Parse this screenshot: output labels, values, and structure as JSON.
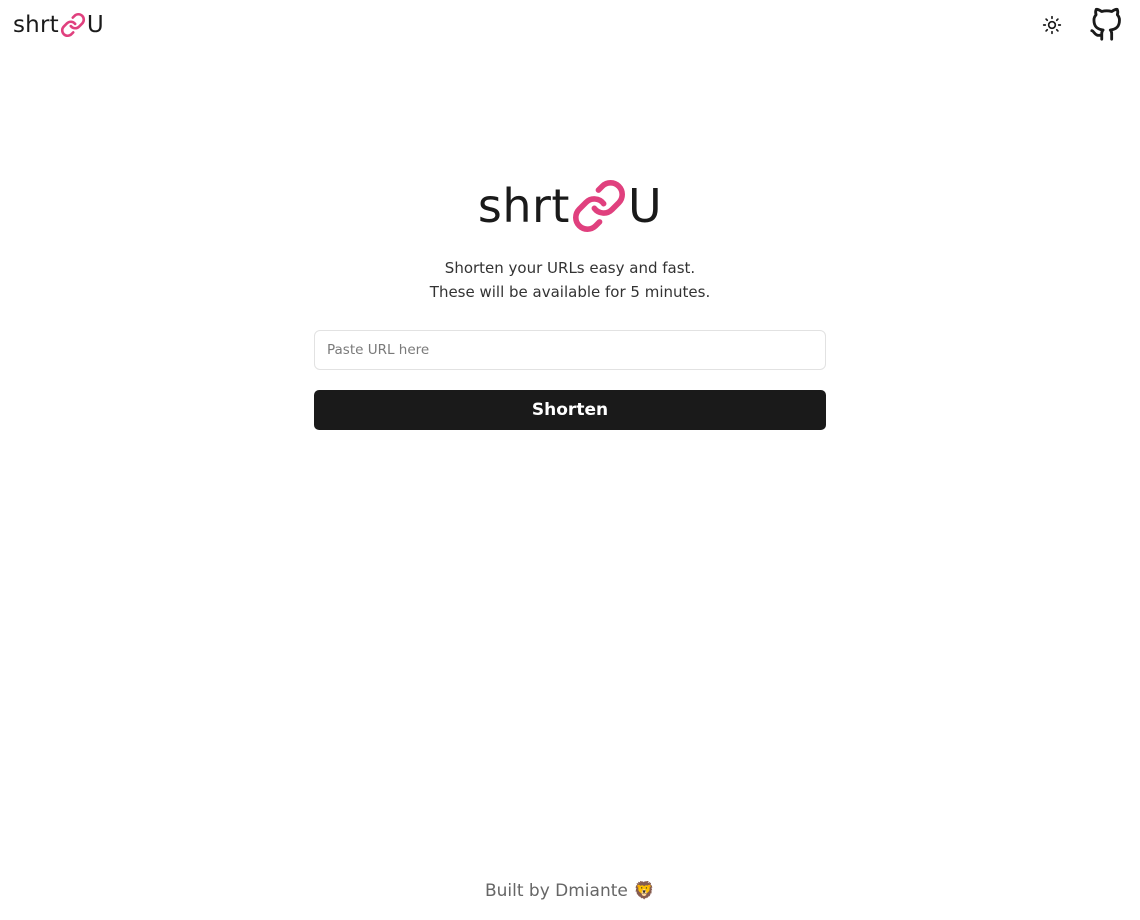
{
  "header": {
    "brand": {
      "prefix": "shrt",
      "suffix": "U"
    },
    "theme_toggle_icon": "sun-icon",
    "github_icon": "github-icon"
  },
  "hero": {
    "brand": {
      "prefix": "shrt",
      "suffix": "U"
    },
    "tagline_line1": "Shorten your URLs easy and fast.",
    "tagline_line2": "These will be available for 5 minutes."
  },
  "form": {
    "url_input": {
      "placeholder": "Paste URL here",
      "value": ""
    },
    "submit_label": "Shorten"
  },
  "footer": {
    "text": "Built by Dmiante",
    "emoji": "🦁"
  },
  "colors": {
    "accent": "#e0407e",
    "button_bg": "#1a1a1a",
    "text": "#1a1a1a"
  }
}
